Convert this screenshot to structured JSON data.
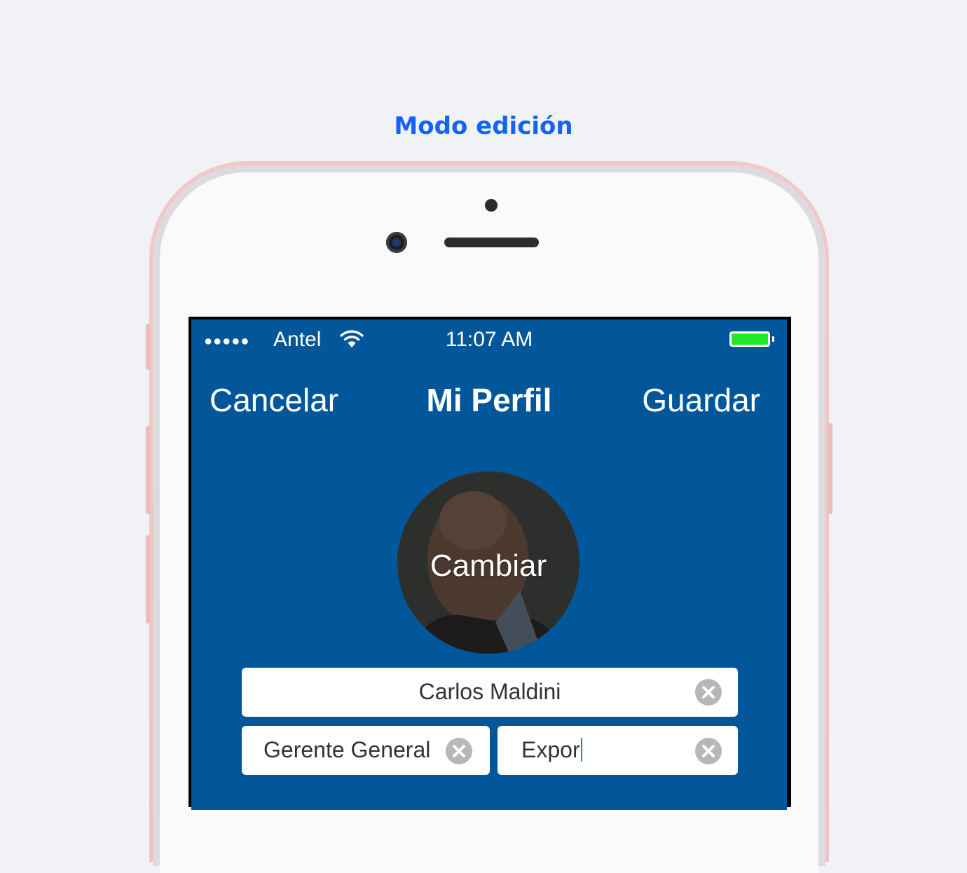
{
  "page": {
    "heading": "Modo edición"
  },
  "status_bar": {
    "signal": "●●●●●",
    "carrier": "Antel",
    "wifi_icon": "wifi-icon",
    "time": "11:07 AM",
    "battery_icon": "battery-icon",
    "battery_level": 1.0,
    "battery_color": "#22e82a"
  },
  "nav": {
    "cancel_label": "Cancelar",
    "title": "Mi Perfil",
    "save_label": "Guardar"
  },
  "profile": {
    "photo_action_label": "Cambiar",
    "name_value": "Carlos Maldini",
    "position_value": "Gerente General",
    "company_value": "Expor"
  },
  "colors": {
    "background": "#f1f2f6",
    "heading": "#1463f3",
    "screen": "#02579b",
    "phone_frame": "#efc2bf"
  }
}
